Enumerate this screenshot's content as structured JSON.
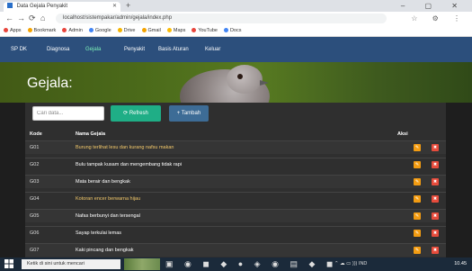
{
  "browser": {
    "tab_title": "Data Gejala Penyakit",
    "new_tab": "+",
    "nav_icons": [
      "←",
      "→",
      "⟳",
      "⌂"
    ],
    "window_controls": "– ▢ ✕",
    "address": "localhost/sistempakar/admin/gejala/index.php",
    "addr_icons": "☆ ⚙ ⋮",
    "bookmarks": [
      {
        "label": "Apps",
        "color": "#e8453c"
      },
      {
        "label": "Bookmark",
        "color": "#f4a300"
      },
      {
        "label": "Admin",
        "color": "#e8453c"
      },
      {
        "label": "Google",
        "color": "#4285f4"
      },
      {
        "label": "Drive",
        "color": "#f4b400"
      },
      {
        "label": "Gmail",
        "color": "#f4a300"
      },
      {
        "label": "Maps",
        "color": "#fbbc05"
      },
      {
        "label": "YouTube",
        "color": "#e8453c"
      },
      {
        "label": "Docs",
        "color": "#4285f4"
      }
    ]
  },
  "appnav": {
    "items": [
      "SP DK",
      "Diagnosa",
      "Gejala",
      "Penyakit",
      "Basis Aturan",
      "Keluar"
    ]
  },
  "page": {
    "title": "Gejala:"
  },
  "toolbar": {
    "search_placeholder": "Cari data...",
    "refresh_label": "⟳ Refresh",
    "add_label": "+ Tambah"
  },
  "table": {
    "headers": [
      "Kode",
      "Nama Gejala",
      "Aksi"
    ],
    "rows": [
      {
        "code": "G01",
        "name": "Burung terlihat lesu dan kurang nafsu makan",
        "highlight": true
      },
      {
        "code": "G02",
        "name": "Bulu tampak kusam dan mengembang tidak rapi"
      },
      {
        "code": "G03",
        "name": "Mata berair dan bengkak"
      },
      {
        "code": "G04",
        "name": "Kotoran encer berwarna hijau",
        "highlight": true
      },
      {
        "code": "G05",
        "name": "Nafas berbunyi dan tersengal"
      },
      {
        "code": "G06",
        "name": "Sayap terkulai lemas"
      },
      {
        "code": "G07",
        "name": "Kaki pincang dan bengkak"
      }
    ],
    "edit_icon": "✎",
    "delete_icon": "✖"
  },
  "taskbar": {
    "search_text": "Ketik di sini untuk mencari",
    "apps": "▣ ◉ ◼ ◆ ● ◈ ◉ ▤ ◆ ◼",
    "status": "⌃ ☁ ▭ ))) IND",
    "clock": "10.45"
  },
  "colors": {
    "nav_bg": "#2c4f7c",
    "active": "#7cf2b8",
    "green_button": "#1fae86",
    "blue_button": "#3d6c96",
    "edit": "#f39c12",
    "delete": "#e74c3c",
    "highlight_text": "#f3c96a"
  }
}
